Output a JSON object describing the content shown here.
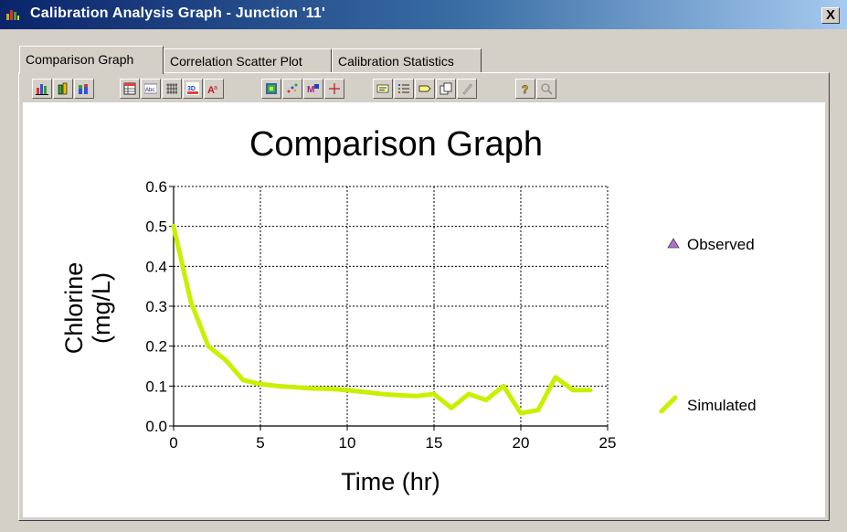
{
  "window": {
    "title": "Calibration Analysis Graph - Junction '11'",
    "close_label": "X"
  },
  "tabs": [
    {
      "label": "Comparison Graph",
      "active": true
    },
    {
      "label": "Correlation Scatter Plot",
      "active": false
    },
    {
      "label": "Calibration Statistics",
      "active": false
    }
  ],
  "toolbar": {
    "buttons": [
      "bar-chart",
      "3d-bar-chart",
      "stacked-bar-chart",
      "data-grid",
      "text-label",
      "gridlines",
      "3d-view",
      "font",
      "color-palette",
      "markers",
      "series-style",
      "crosshair",
      "title-bar",
      "legend",
      "tag",
      "copy",
      "edit",
      "help",
      "zoom"
    ]
  },
  "chart_data": {
    "type": "line",
    "title": "Comparison Graph",
    "xlabel": "Time (hr)",
    "ylabel": [
      "Chlorine",
      "(mg/L)"
    ],
    "xlim": [
      0,
      25
    ],
    "ylim": [
      0.0,
      0.6
    ],
    "xticks": [
      "0",
      "5",
      "10",
      "15",
      "20",
      "25"
    ],
    "yticks": [
      "0.0",
      "0.1",
      "0.2",
      "0.3",
      "0.4",
      "0.5",
      "0.6"
    ],
    "grid": true,
    "legend_position": "right",
    "series": [
      {
        "name": "Observed",
        "marker": "triangle",
        "color": "#b070d0",
        "points": []
      },
      {
        "name": "Simulated",
        "color": "#c8f000",
        "points": [
          [
            0,
            0.5
          ],
          [
            1,
            0.31
          ],
          [
            2,
            0.2
          ],
          [
            3,
            0.165
          ],
          [
            4,
            0.115
          ],
          [
            5,
            0.105
          ],
          [
            6,
            0.1
          ],
          [
            7,
            0.097
          ],
          [
            8,
            0.094
          ],
          [
            9,
            0.093
          ],
          [
            10,
            0.09
          ],
          [
            11,
            0.085
          ],
          [
            12,
            0.08
          ],
          [
            13,
            0.077
          ],
          [
            14,
            0.075
          ],
          [
            15,
            0.08
          ],
          [
            16,
            0.045
          ],
          [
            17,
            0.08
          ],
          [
            18,
            0.065
          ],
          [
            19,
            0.1
          ],
          [
            20,
            0.032
          ],
          [
            21,
            0.04
          ],
          [
            22,
            0.122
          ],
          [
            23,
            0.09
          ],
          [
            24,
            0.09
          ]
        ]
      }
    ]
  }
}
